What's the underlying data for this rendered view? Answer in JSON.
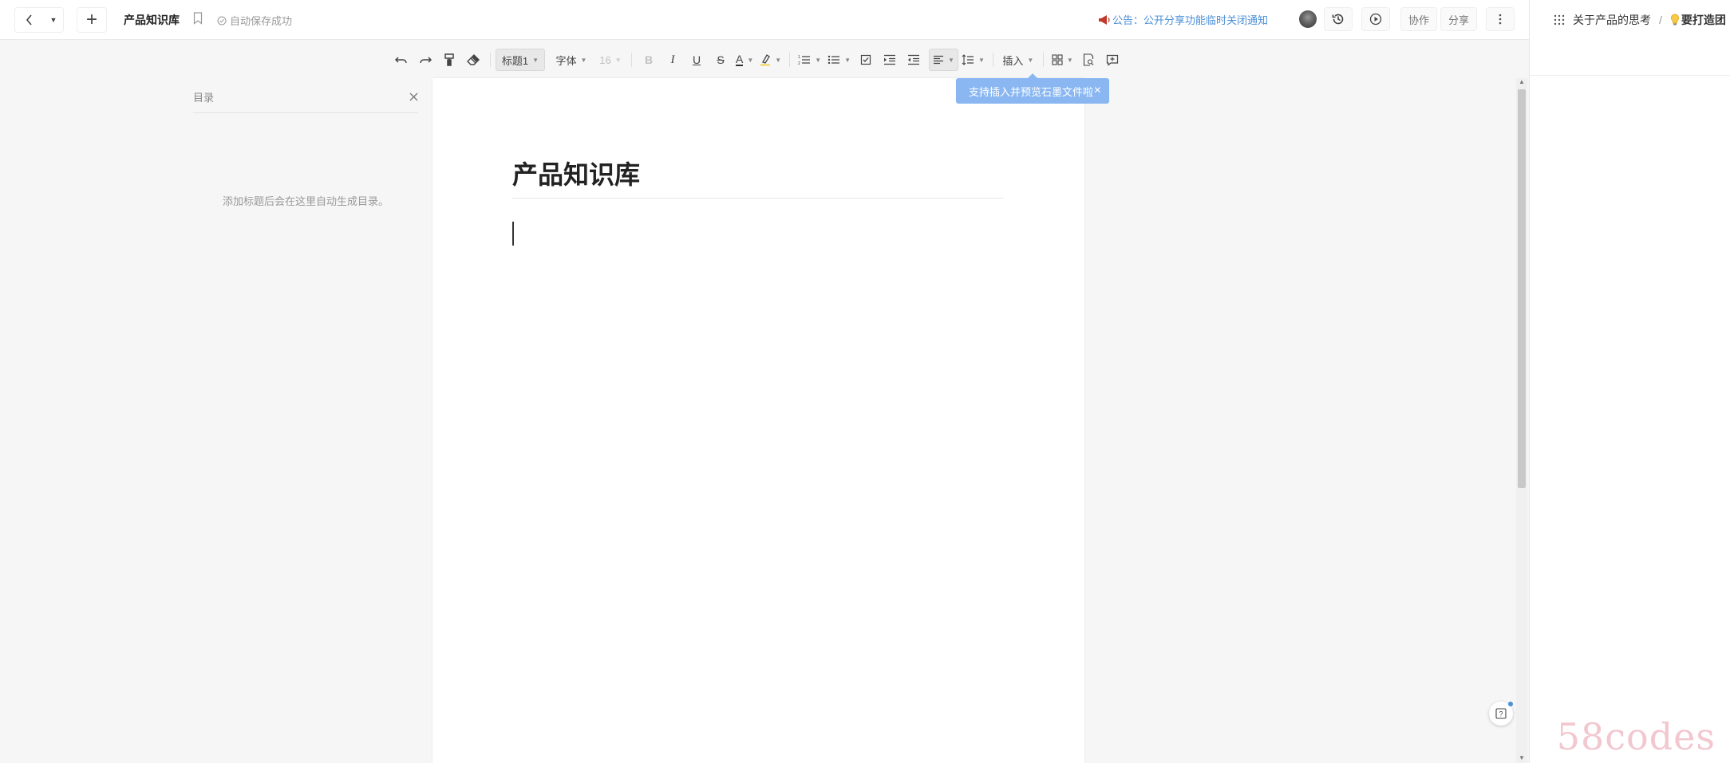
{
  "header": {
    "doc_title": "产品知识库",
    "save_status": "自动保存成功",
    "announcement": "公告：公开分享功能临时关闭通知",
    "collab_label": "协作",
    "share_label": "分享"
  },
  "right_panel": {
    "breadcrumb_parent": "关于产品的思考",
    "breadcrumb_sep": "/",
    "breadcrumb_current": "要打造团"
  },
  "toolbar": {
    "heading_style": "标题1",
    "font_family": "字体",
    "font_size": "16",
    "insert_label": "插入"
  },
  "toc": {
    "title": "目录",
    "empty_hint": "添加标题后会在这里自动生成目录。"
  },
  "document": {
    "title": "产品知识库"
  },
  "tooltip": {
    "text": "支持插入并预览石墨文件啦"
  },
  "watermark": "58codes",
  "colors": {
    "accent": "#4a8fd8",
    "tooltip_bg": "#8ab7f2",
    "announce_icon": "#c0392b"
  }
}
